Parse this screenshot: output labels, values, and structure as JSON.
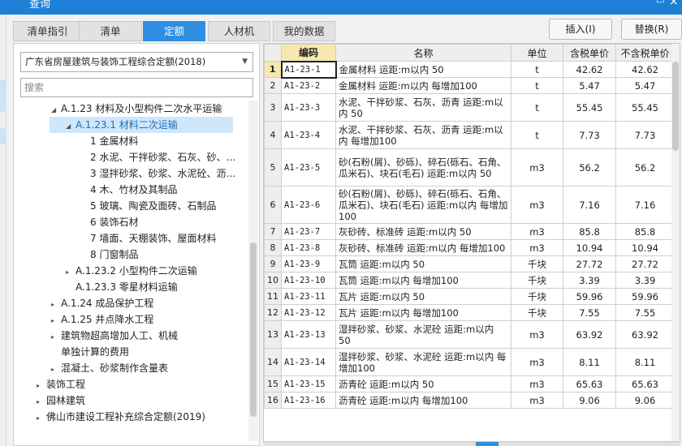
{
  "window": {
    "title": "查询",
    "restore_icon": "restore-icon",
    "close_icon": "close-icon"
  },
  "tabs": [
    {
      "label": "清单指引",
      "active": false
    },
    {
      "label": "清单",
      "active": false
    },
    {
      "label": "定额",
      "active": true
    },
    {
      "label": "人材机",
      "active": false
    },
    {
      "label": "我的数据",
      "active": false
    }
  ],
  "buttons": {
    "insert": "插入(I)",
    "replace": "替换(R)"
  },
  "quota_select": {
    "value": "广东省房屋建筑与装饰工程综合定额(2018)"
  },
  "search": {
    "placeholder": "搜索"
  },
  "tree": [
    {
      "label": "A.1.23 材料及小型构件二次水平运输",
      "arrow": "◢"
    },
    {
      "label": "A.1.23.1 材料二次运输",
      "arrow": "◢",
      "selected": true
    },
    {
      "label": "1 金属材料",
      "arrow": ""
    },
    {
      "label": "2 水泥、干拌砂浆、石灰、砂、…",
      "arrow": ""
    },
    {
      "label": "3 湿拌砂浆、砂浆、水泥砼、沥…",
      "arrow": ""
    },
    {
      "label": "4 木、竹材及其制品",
      "arrow": ""
    },
    {
      "label": "5 玻璃、陶瓷及面砖、石制品",
      "arrow": ""
    },
    {
      "label": "6 装饰石材",
      "arrow": ""
    },
    {
      "label": "7 墙面、天棚装饰、屋面材料",
      "arrow": ""
    },
    {
      "label": "8 门窗制品",
      "arrow": ""
    },
    {
      "label": "A.1.23.2 小型构件二次运输",
      "arrow": "▸"
    },
    {
      "label": "A.1.23.3 零星材料运输",
      "arrow": ""
    },
    {
      "label": "A.1.24 成品保护工程",
      "arrow": "▸"
    },
    {
      "label": "A.1.25 井点降水工程",
      "arrow": "▸"
    },
    {
      "label": "建筑物超高增加人工、机械",
      "arrow": "▸"
    },
    {
      "label": "单独计算的费用",
      "arrow": ""
    },
    {
      "label": "混凝土、砂浆制作含量表",
      "arrow": "▸"
    },
    {
      "label": "装饰工程",
      "arrow": "▸"
    },
    {
      "label": "园林建筑",
      "arrow": "▸"
    },
    {
      "label": "佛山市建设工程补充综合定额(2019)",
      "arrow": "▸"
    }
  ],
  "grid": {
    "headers": [
      "",
      "编码",
      "名称",
      "单位",
      "含税单价",
      "不含税单价"
    ],
    "rows": [
      {
        "n": "1",
        "code": "A1-23-1",
        "name": "金属材料 运距:m以内 50",
        "unit": "t",
        "tax": "42.62",
        "notax": "42.62"
      },
      {
        "n": "2",
        "code": "A1-23-2",
        "name": "金属材料 运距:m以内 每增加100",
        "unit": "t",
        "tax": "5.47",
        "notax": "5.47"
      },
      {
        "n": "3",
        "code": "A1-23-3",
        "name": "水泥、干拌砂浆、石灰、沥青 运距:m以内 50",
        "unit": "t",
        "tax": "55.45",
        "notax": "55.45"
      },
      {
        "n": "4",
        "code": "A1-23-4",
        "name": "水泥、干拌砂浆、石灰、沥青 运距:m以内 每增加100",
        "unit": "t",
        "tax": "7.73",
        "notax": "7.73"
      },
      {
        "n": "5",
        "code": "A1-23-5",
        "name": "砂(石粉(屑)、砂砾)、碎石(砾石、石角、瓜米石)、块石(毛石) 运距:m以内 50",
        "unit": "m3",
        "tax": "56.2",
        "notax": "56.2"
      },
      {
        "n": "6",
        "code": "A1-23-6",
        "name": "砂(石粉(屑)、砂砾)、碎石(砾石、石角、瓜米石)、块石(毛石) 运距:m以内 每增加100",
        "unit": "m3",
        "tax": "7.16",
        "notax": "7.16"
      },
      {
        "n": "7",
        "code": "A1-23-7",
        "name": "灰砂砖、标准砖 运距:m以内 50",
        "unit": "m3",
        "tax": "85.8",
        "notax": "85.8"
      },
      {
        "n": "8",
        "code": "A1-23-8",
        "name": "灰砂砖、标准砖 运距:m以内 每增加100",
        "unit": "m3",
        "tax": "10.94",
        "notax": "10.94"
      },
      {
        "n": "9",
        "code": "A1-23-9",
        "name": "瓦筒 运距:m以内 50",
        "unit": "千块",
        "tax": "27.72",
        "notax": "27.72"
      },
      {
        "n": "10",
        "code": "A1-23-10",
        "name": "瓦筒 运距:m以内 每增加100",
        "unit": "千块",
        "tax": "3.39",
        "notax": "3.39"
      },
      {
        "n": "11",
        "code": "A1-23-11",
        "name": "瓦片 运距:m以内 50",
        "unit": "千块",
        "tax": "59.96",
        "notax": "59.96"
      },
      {
        "n": "12",
        "code": "A1-23-12",
        "name": "瓦片 运距:m以内 每增加100",
        "unit": "千块",
        "tax": "7.55",
        "notax": "7.55"
      },
      {
        "n": "13",
        "code": "A1-23-13",
        "name": "湿拌砂浆、砂浆、水泥砼 运距:m以内 50",
        "unit": "m3",
        "tax": "63.92",
        "notax": "63.92"
      },
      {
        "n": "14",
        "code": "A1-23-14",
        "name": "湿拌砂浆、砂浆、水泥砼 运距:m以内 每增加100",
        "unit": "m3",
        "tax": "8.11",
        "notax": "8.11"
      },
      {
        "n": "15",
        "code": "A1-23-15",
        "name": "沥青砼 运距:m以内 50",
        "unit": "m3",
        "tax": "65.63",
        "notax": "65.63"
      },
      {
        "n": "16",
        "code": "A1-23-16",
        "name": "沥青砼 运距:m以内 每增加100",
        "unit": "m3",
        "tax": "9.06",
        "notax": "9.06"
      }
    ]
  },
  "colors": {
    "accent": "#2e8ee0",
    "selected_header": "#f7e7b0",
    "titlebar": "#1e7fd6"
  }
}
